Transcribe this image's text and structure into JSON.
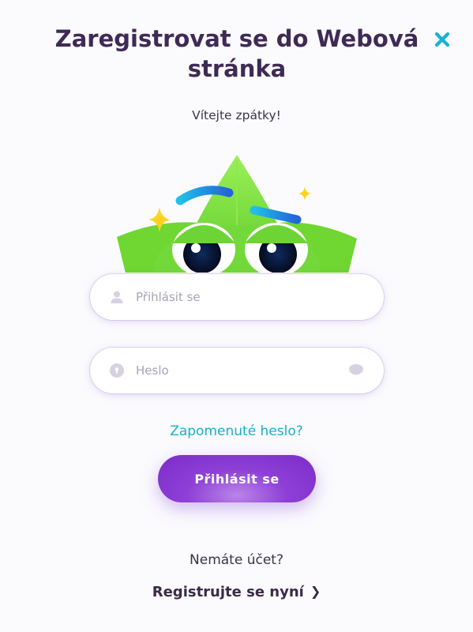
{
  "header": {
    "title": "Zaregistrovat se do Webová stránka",
    "close_icon": "close-icon"
  },
  "greeting": "Vítejte zpátky!",
  "mascot": {
    "icon": "leaf-mascot-illustration",
    "colors": {
      "leaf": "#7ee03c",
      "brow": "#1e88e5",
      "sparkle": "#ffd21f"
    }
  },
  "form": {
    "username": {
      "placeholder": "Přihlásit se",
      "value": "",
      "icon": "user-icon"
    },
    "password": {
      "placeholder": "Heslo",
      "value": "",
      "icon": "lock-icon",
      "toggle_icon": "eye-icon"
    },
    "forgot_label": "Zapomenuté heslo?",
    "submit_label": "Přihlásit se"
  },
  "footer": {
    "question": "Nemáte účet?",
    "register_label": "Registrujte se nyní",
    "register_icon": "chevron-right-icon"
  },
  "colors": {
    "title": "#3f2a55",
    "accent": "#1aaecb",
    "button": "#8e3fd6",
    "background": "#fbfbfe"
  }
}
